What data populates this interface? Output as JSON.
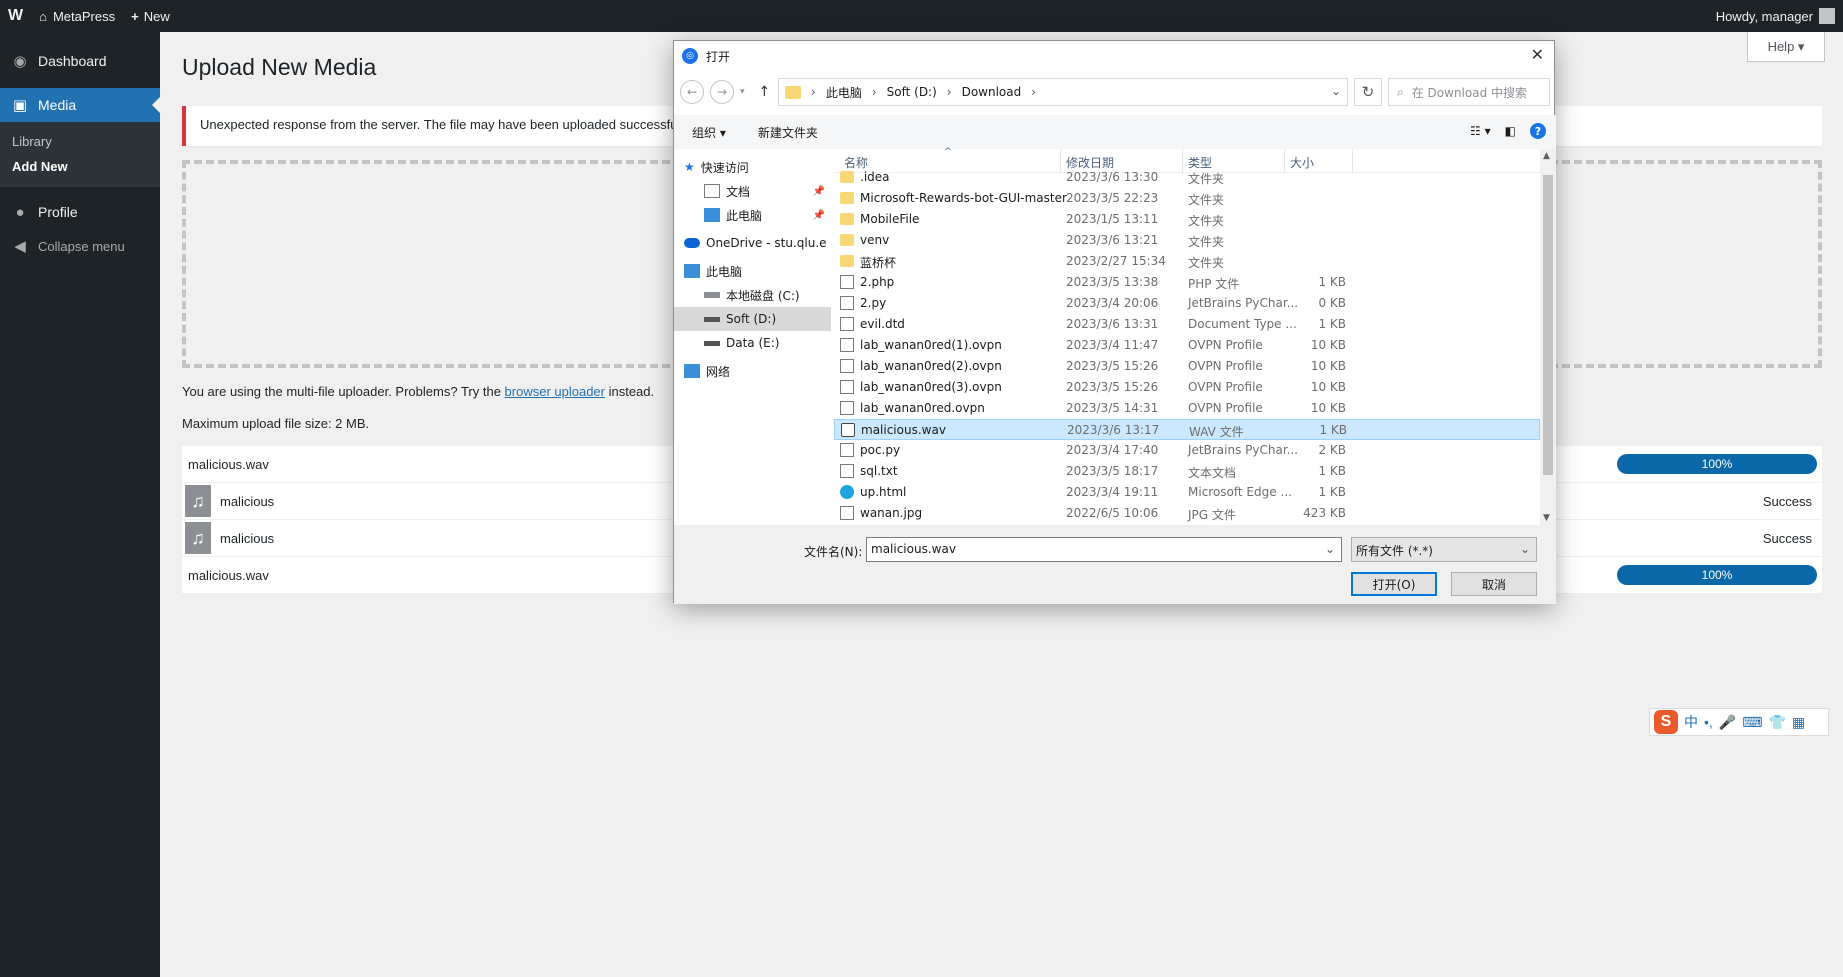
{
  "adminbar": {
    "wp_logo": "W",
    "site_name": "MetaPress",
    "new_label": "New",
    "howdy": "Howdy, manager"
  },
  "sidebar": {
    "dashboard": "Dashboard",
    "media": "Media",
    "library": "Library",
    "add_new": "Add New",
    "profile": "Profile",
    "collapse": "Collapse menu"
  },
  "main": {
    "title": "Upload New Media",
    "help": "Help ▾",
    "notice": "Unexpected response from the server. The file may have been uploaded successful",
    "uploader_note_prefix": "You are using the multi-file uploader. Problems? Try the ",
    "uploader_link": "browser uploader",
    "uploader_note_suffix": " instead.",
    "max_size": "Maximum upload file size: 2 MB.",
    "items": [
      {
        "name": "malicious.wav",
        "progress": "100%"
      },
      {
        "name": "malicious",
        "status": "Success"
      },
      {
        "name": "malicious",
        "status": "Success"
      },
      {
        "name": "malicious.wav",
        "progress": "100%"
      }
    ]
  },
  "ime": {
    "logo": "S",
    "zh": "中",
    "punct": "•,",
    "mic": "🎤",
    "kbd": "⌨",
    "shirt": "👕",
    "grid": "▦"
  },
  "dialog": {
    "title": "打开",
    "close": "✕",
    "path": [
      "此电脑",
      "Soft (D:)",
      "Download"
    ],
    "search_placeholder": "在 Download 中搜索",
    "organize": "组织 ▾",
    "new_folder": "新建文件夹",
    "nav": {
      "quick_access": "快速访问",
      "documents": "文档",
      "this_pc_pin": "此电脑",
      "onedrive": "OneDrive - stu.qlu.e",
      "this_pc": "此电脑",
      "local_c": "本地磁盘 (C:)",
      "soft_d": "Soft (D:)",
      "data_e": "Data (E:)",
      "network": "网络"
    },
    "columns": {
      "name": "名称",
      "date": "修改日期",
      "type": "类型",
      "size": "大小"
    },
    "files": [
      {
        "name": ".idea",
        "date": "2023/3/6 13:30",
        "type": "文件夹",
        "size": "",
        "icon": "folder"
      },
      {
        "name": "Microsoft-Rewards-bot-GUI-master",
        "date": "2023/3/5 22:23",
        "type": "文件夹",
        "size": "",
        "icon": "folder"
      },
      {
        "name": "MobileFile",
        "date": "2023/1/5 13:11",
        "type": "文件夹",
        "size": "",
        "icon": "folder"
      },
      {
        "name": "venv",
        "date": "2023/3/6 13:21",
        "type": "文件夹",
        "size": "",
        "icon": "folder"
      },
      {
        "name": "蓝桥杯",
        "date": "2023/2/27 15:34",
        "type": "文件夹",
        "size": "",
        "icon": "folder"
      },
      {
        "name": "2.php",
        "date": "2023/3/5 13:38",
        "type": "PHP 文件",
        "size": "1 KB",
        "icon": "doc"
      },
      {
        "name": "2.py",
        "date": "2023/3/4 20:06",
        "type": "JetBrains PyChar...",
        "size": "0 KB",
        "icon": "doc"
      },
      {
        "name": "evil.dtd",
        "date": "2023/3/6 13:31",
        "type": "Document Type ...",
        "size": "1 KB",
        "icon": "doc"
      },
      {
        "name": "lab_wanan0red(1).ovpn",
        "date": "2023/3/4 11:47",
        "type": "OVPN Profile",
        "size": "10 KB",
        "icon": "doc"
      },
      {
        "name": "lab_wanan0red(2).ovpn",
        "date": "2023/3/5 15:26",
        "type": "OVPN Profile",
        "size": "10 KB",
        "icon": "doc"
      },
      {
        "name": "lab_wanan0red(3).ovpn",
        "date": "2023/3/5 15:26",
        "type": "OVPN Profile",
        "size": "10 KB",
        "icon": "doc"
      },
      {
        "name": "lab_wanan0red.ovpn",
        "date": "2023/3/5 14:31",
        "type": "OVPN Profile",
        "size": "10 KB",
        "icon": "doc"
      },
      {
        "name": "malicious.wav",
        "date": "2023/3/6 13:17",
        "type": "WAV 文件",
        "size": "1 KB",
        "icon": "wav",
        "selected": true
      },
      {
        "name": "poc.py",
        "date": "2023/3/4 17:40",
        "type": "JetBrains PyChar...",
        "size": "2 KB",
        "icon": "doc"
      },
      {
        "name": "sql.txt",
        "date": "2023/3/5 18:17",
        "type": "文本文档",
        "size": "1 KB",
        "icon": "doc"
      },
      {
        "name": "up.html",
        "date": "2023/3/4 19:11",
        "type": "Microsoft Edge ...",
        "size": "1 KB",
        "icon": "edge"
      },
      {
        "name": "wanan.jpg",
        "date": "2022/6/5 10:06",
        "type": "JPG 文件",
        "size": "423 KB",
        "icon": "img"
      }
    ],
    "filename_label": "文件名(N):",
    "filename_value": "malicious.wav",
    "filter": "所有文件 (*.*)",
    "open_btn": "打开(O)",
    "cancel_btn": "取消"
  }
}
